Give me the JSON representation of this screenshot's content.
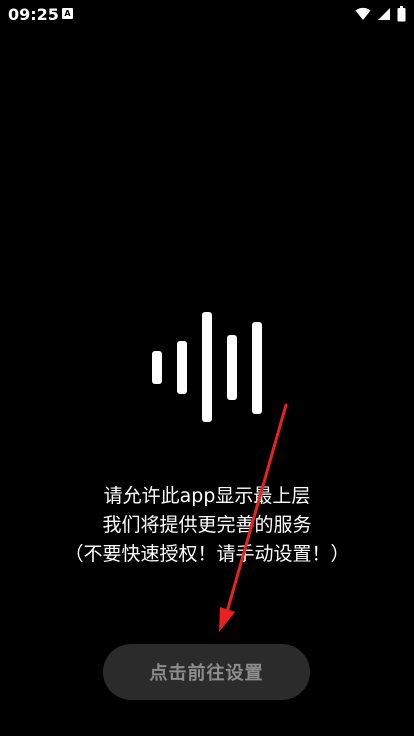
{
  "status_bar": {
    "time": "09:25",
    "notification_badge": "A",
    "icons": [
      "wifi-icon",
      "signal-icon",
      "battery-icon"
    ]
  },
  "waveform": {
    "icon": "sound-wave-icon",
    "color": "#ffffff"
  },
  "message": {
    "line1": "请允许此app显示最上层",
    "line2": "我们将提供更完善的服务",
    "line3": "（不要快速授权！请手动设置！）"
  },
  "arrow": {
    "icon": "red-arrow-icon",
    "color": "#e8231f"
  },
  "settings_button": {
    "label": "点击前往设置",
    "background": "#2b2b2b",
    "text_color": "#8d8d8d"
  }
}
